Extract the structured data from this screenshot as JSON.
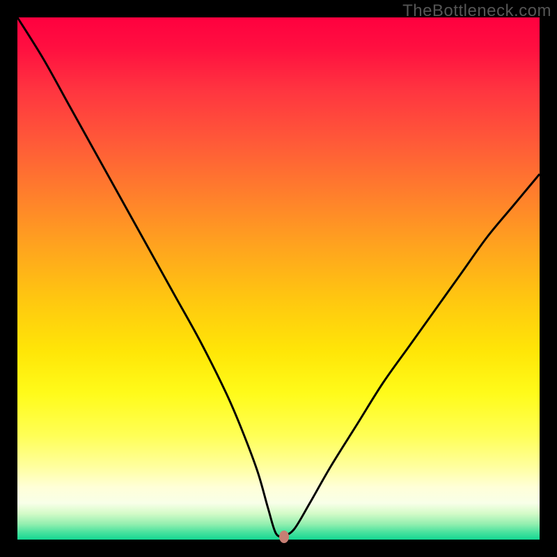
{
  "watermark": "TheBottleneck.com",
  "chart_data": {
    "type": "line",
    "title": "",
    "xlabel": "",
    "ylabel": "",
    "xlim": [
      0,
      100
    ],
    "ylim": [
      0,
      100
    ],
    "grid": false,
    "legend": false,
    "background": "rainbow-gradient (red top → green bottom)",
    "series": [
      {
        "name": "bottleneck-curve",
        "color": "#000000",
        "x": [
          0,
          5,
          10,
          15,
          20,
          25,
          30,
          35,
          40,
          43,
          46,
          48,
          49.5,
          51,
          53,
          56,
          60,
          65,
          70,
          75,
          80,
          85,
          90,
          95,
          100
        ],
        "y": [
          100,
          92,
          83,
          74,
          65,
          56,
          47,
          38,
          28,
          21,
          13,
          6,
          1.2,
          0.8,
          2,
          7,
          14,
          22,
          30,
          37,
          44,
          51,
          58,
          64,
          70
        ]
      }
    ],
    "marker": {
      "x": 51,
      "y": 0.6,
      "color": "#c77f74"
    },
    "annotations": []
  }
}
